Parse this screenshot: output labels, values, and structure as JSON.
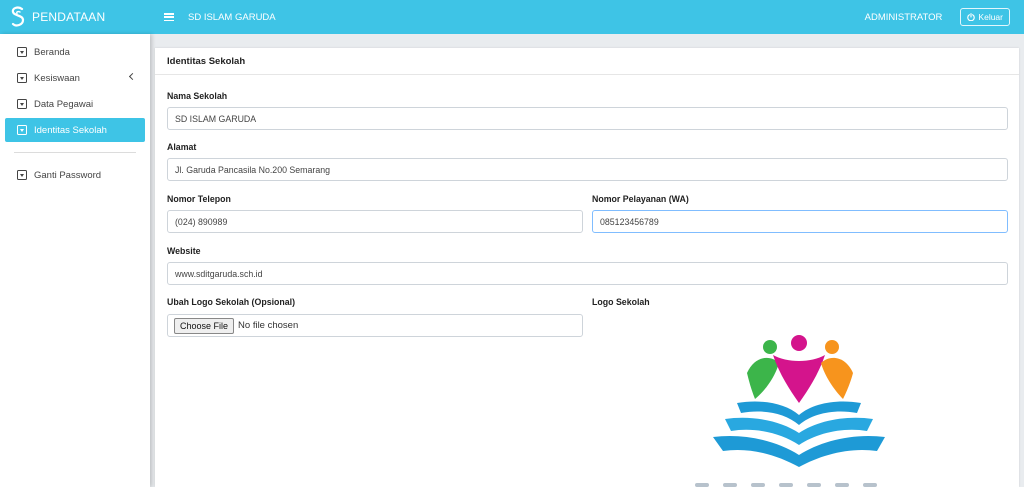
{
  "navbar": {
    "brand": "PENDATAAN",
    "school_name": "SD ISLAM GARUDA",
    "admin": "ADMINISTRATOR",
    "logout": "Keluar"
  },
  "sidebar": {
    "items": [
      {
        "label": "Beranda"
      },
      {
        "label": "Kesiswaan"
      },
      {
        "label": "Data Pegawai"
      },
      {
        "label": "Identitas Sekolah"
      },
      {
        "label": "Ganti Password"
      }
    ]
  },
  "card": {
    "title": "Identitas Sekolah"
  },
  "form": {
    "nama_label": "Nama Sekolah",
    "nama_value": "SD ISLAM GARUDA",
    "alamat_label": "Alamat",
    "alamat_value": "Jl. Garuda Pancasila No.200 Semarang",
    "telepon_label": "Nomor Telepon",
    "telepon_value": "(024) 890989",
    "wa_label": "Nomor Pelayanan (WA)",
    "wa_value": "085123456789",
    "website_label": "Website",
    "website_value": "www.sditgaruda.sch.id",
    "logo_upload_label": "Ubah Logo Sekolah (Opsional)",
    "choose_file": "Choose File",
    "no_file": "No file chosen",
    "logo_label": "Logo Sekolah"
  },
  "colors": {
    "accent": "#3ec4e6",
    "logo_green": "#3cb54a",
    "logo_magenta": "#d4148c",
    "logo_orange": "#f7941d",
    "logo_blue": "#1e9ad6"
  }
}
